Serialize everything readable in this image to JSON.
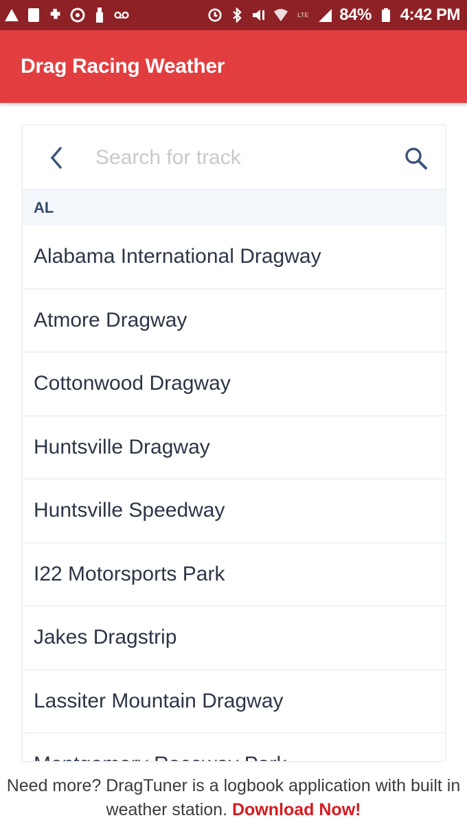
{
  "status_bar": {
    "left_icons": [
      "warning-icon",
      "document-icon",
      "puzzle-icon",
      "target-icon",
      "usb-icon",
      "voicemail-icon"
    ],
    "right_icons": [
      "sync-icon",
      "bluetooth-icon",
      "mute-icon",
      "wifi-icon",
      "lte-icon",
      "signal-icon"
    ],
    "battery": "84%",
    "time": "4:42 PM"
  },
  "app_bar": {
    "title": "Drag Racing Weather",
    "color": "#e23e40"
  },
  "search": {
    "placeholder": "Search for track",
    "value": ""
  },
  "track_list": {
    "section": "AL",
    "items": [
      "Alabama International Dragway",
      "Atmore Dragway",
      "Cottonwood Dragway",
      "Huntsville Dragway",
      "Huntsville Speedway",
      "I22 Motorsports Park",
      "Jakes Dragstrip",
      "Lassiter Mountain Dragway",
      "Montgomery Raceway Park"
    ]
  },
  "footer": {
    "text": "Need more? DragTuner is a logbook application with built in weather station.",
    "link_label": "Download Now!",
    "link_color": "#d61a1f"
  }
}
